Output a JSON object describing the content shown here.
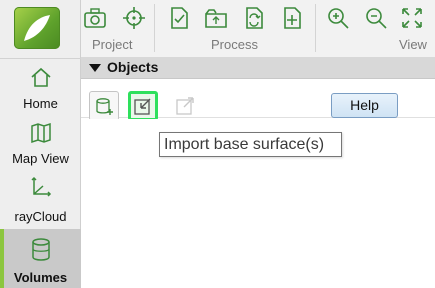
{
  "sidebar": {
    "items": [
      {
        "label": "Home",
        "icon": "home-icon"
      },
      {
        "label": "Map View",
        "icon": "map-icon"
      },
      {
        "label": "rayCloud",
        "icon": "axes-icon"
      },
      {
        "label": "Volumes",
        "icon": "cylinder-icon",
        "selected": true
      }
    ]
  },
  "toolbar": {
    "groups": [
      {
        "label": "Project"
      },
      {
        "label": "Process"
      },
      {
        "label": "View"
      }
    ]
  },
  "objects": {
    "title": "Objects",
    "help_label": "Help",
    "tooltip": "Import base surface(s)"
  },
  "colors": {
    "accent": "#8cc63f",
    "highlight": "#2ee05c",
    "help_border": "#7a9dc3"
  }
}
